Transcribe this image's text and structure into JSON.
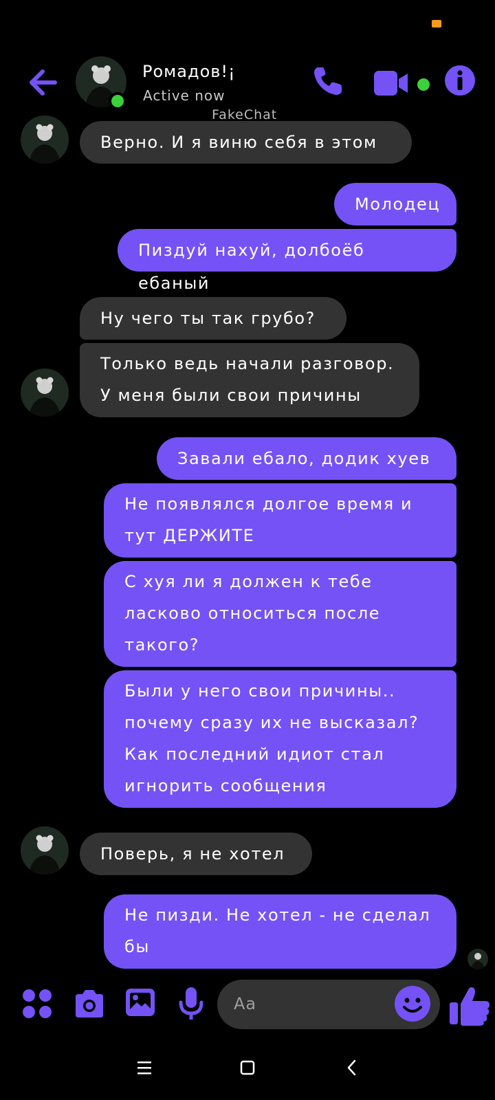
{
  "header": {
    "contact_name": "Ромадов!¡",
    "status": "Active now",
    "watermark": "FakeChat"
  },
  "icons": {
    "back": "arrow-left-icon",
    "call": "phone-icon",
    "video": "video-camera-icon",
    "info": "info-icon",
    "apps": "grid-dots-icon",
    "camera": "camera-icon",
    "gallery": "image-icon",
    "voice": "microphone-icon",
    "emoji": "smiley-icon",
    "like": "thumbs-up-icon"
  },
  "colors": {
    "accent": "#7452f5",
    "incoming_bubble": "#333333",
    "online": "#3bd13b",
    "battery": "#f29b1c"
  },
  "messages": [
    {
      "from": "contact",
      "text": "Верно. И я виню себя в этом"
    },
    {
      "from": "me",
      "text": "Молодец"
    },
    {
      "from": "me",
      "text": "Пиздуй нахуй, долбоёб ебаный"
    },
    {
      "from": "contact",
      "text": "Ну чего ты так грубо?"
    },
    {
      "from": "contact",
      "text": "Только ведь начали разговор. У меня были свои причины"
    },
    {
      "from": "me",
      "text": "Завали ебало, додик хуев"
    },
    {
      "from": "me",
      "text": "Не появлялся долгое время и тут ДЕРЖИТЕ"
    },
    {
      "from": "me",
      "text": "С хуя ли я должен к тебе ласково относиться после такого?"
    },
    {
      "from": "me",
      "text": "Были у него свои причины.. почему сразу их не высказал? Как последний идиот стал игнорить сообщения"
    },
    {
      "from": "contact",
      "text": "Поверь, я не хотел"
    },
    {
      "from": "me",
      "text": "Не пизди. Не хотел - не сделал бы"
    }
  ],
  "composer": {
    "placeholder": "Aa"
  },
  "navbar": {
    "menu": "menu-icon",
    "home": "home-icon",
    "back": "back-icon"
  }
}
